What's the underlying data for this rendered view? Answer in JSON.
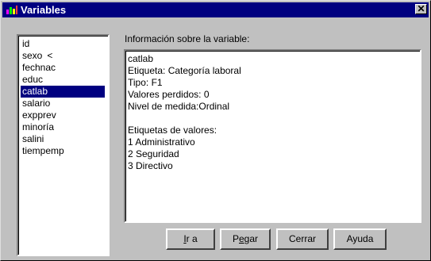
{
  "window": {
    "title": "Variables",
    "close_glyph": "✕"
  },
  "variables": {
    "items": [
      {
        "label": "id"
      },
      {
        "label": "sexo",
        "suffix": "<"
      },
      {
        "label": "fechnac"
      },
      {
        "label": "educ"
      },
      {
        "label": "catlab",
        "selected": true
      },
      {
        "label": "salario"
      },
      {
        "label": "expprev"
      },
      {
        "label": "minoría"
      },
      {
        "label": "salini"
      },
      {
        "label": "tiempemp"
      }
    ]
  },
  "info": {
    "heading": "Información sobre la variable:",
    "lines": [
      "catlab",
      "Etiqueta: Categoría laboral",
      "Tipo: F1",
      "Valores perdidos: 0",
      "Nivel de medida:Ordinal",
      "",
      "Etiquetas de valores:",
      "1 Administrativo",
      "2 Seguridad",
      "3 Directivo"
    ]
  },
  "buttons": {
    "ir": {
      "mnemonic": "I",
      "rest": "r a"
    },
    "pegar": {
      "pre": "P",
      "mnemonic": "e",
      "rest": "gar"
    },
    "cerrar": {
      "label": "Cerrar"
    },
    "ayuda": {
      "label": "Ayuda"
    }
  },
  "colors": {
    "titlebar": "#000080",
    "selection": "#000080",
    "face": "#c0c0c0"
  }
}
